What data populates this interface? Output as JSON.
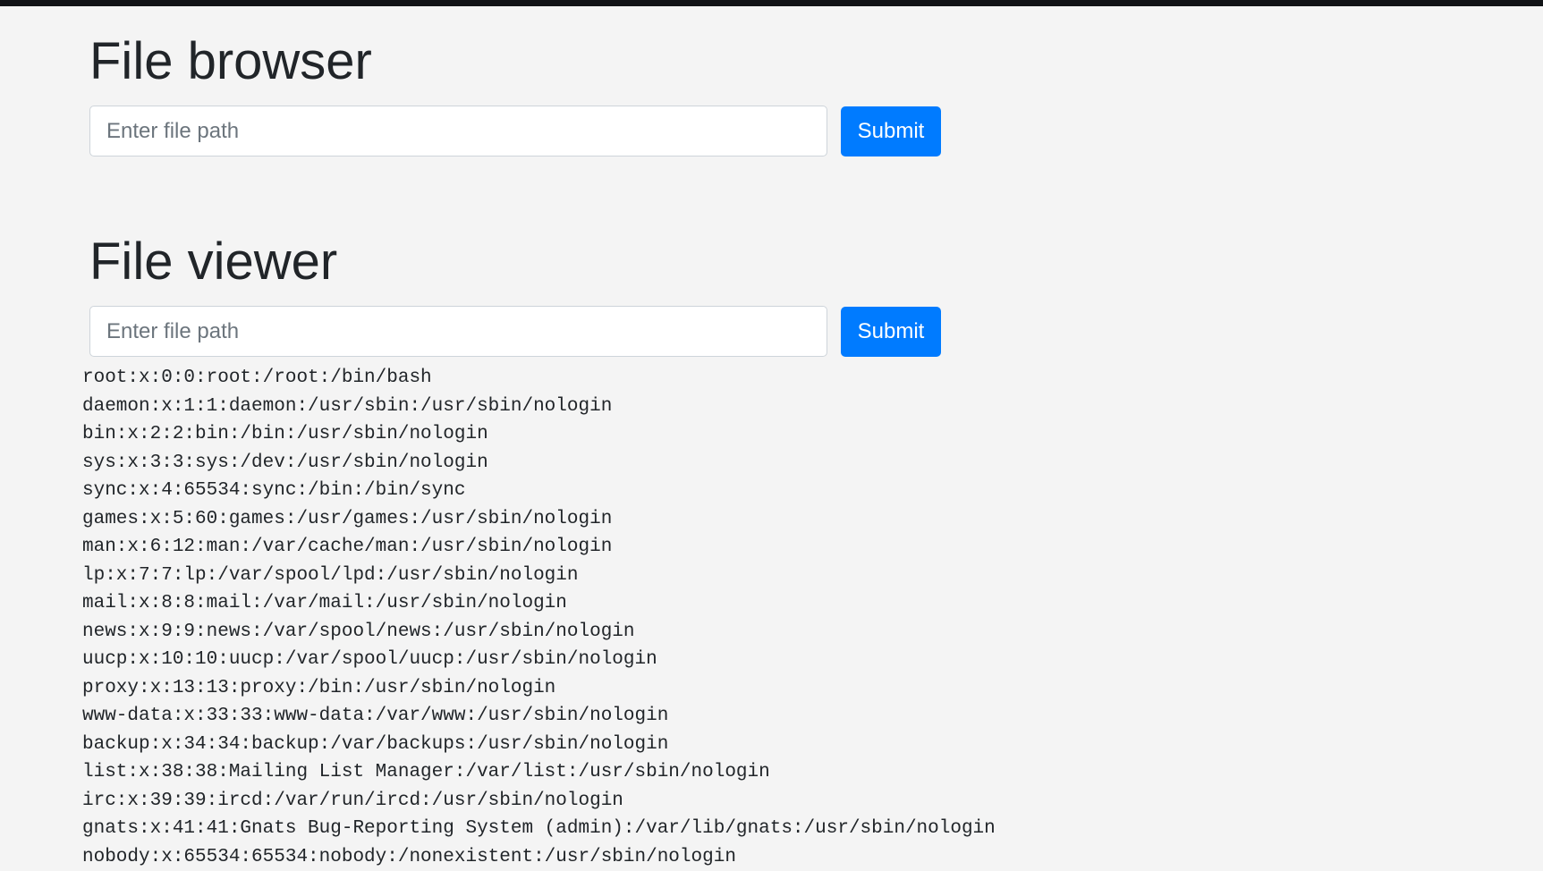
{
  "file_browser": {
    "title": "File browser",
    "input_placeholder": "Enter file path",
    "input_value": "",
    "submit_label": "Submit"
  },
  "file_viewer": {
    "title": "File viewer",
    "input_placeholder": "Enter file path",
    "input_value": "",
    "submit_label": "Submit",
    "content_lines": [
      "root:x:0:0:root:/root:/bin/bash",
      "daemon:x:1:1:daemon:/usr/sbin:/usr/sbin/nologin",
      "bin:x:2:2:bin:/bin:/usr/sbin/nologin",
      "sys:x:3:3:sys:/dev:/usr/sbin/nologin",
      "sync:x:4:65534:sync:/bin:/bin/sync",
      "games:x:5:60:games:/usr/games:/usr/sbin/nologin",
      "man:x:6:12:man:/var/cache/man:/usr/sbin/nologin",
      "lp:x:7:7:lp:/var/spool/lpd:/usr/sbin/nologin",
      "mail:x:8:8:mail:/var/mail:/usr/sbin/nologin",
      "news:x:9:9:news:/var/spool/news:/usr/sbin/nologin",
      "uucp:x:10:10:uucp:/var/spool/uucp:/usr/sbin/nologin",
      "proxy:x:13:13:proxy:/bin:/usr/sbin/nologin",
      "www-data:x:33:33:www-data:/var/www:/usr/sbin/nologin",
      "backup:x:34:34:backup:/var/backups:/usr/sbin/nologin",
      "list:x:38:38:Mailing List Manager:/var/list:/usr/sbin/nologin",
      "irc:x:39:39:ircd:/var/run/ircd:/usr/sbin/nologin",
      "gnats:x:41:41:Gnats Bug-Reporting System (admin):/var/lib/gnats:/usr/sbin/nologin",
      "nobody:x:65534:65534:nobody:/nonexistent:/usr/sbin/nologin"
    ]
  }
}
